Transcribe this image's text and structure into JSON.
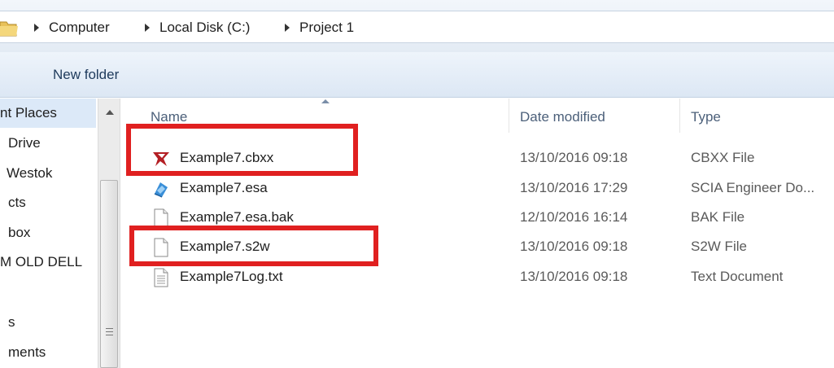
{
  "breadcrumb": [
    "Computer",
    "Local Disk (C:)",
    "Project 1"
  ],
  "toolbar": {
    "new_folder": "New folder"
  },
  "nav": {
    "items": [
      "nt Places",
      "Drive",
      "Westok",
      "cts",
      "box",
      "M OLD DELL",
      "s",
      "ments"
    ]
  },
  "columns": {
    "name": "Name",
    "date": "Date modified",
    "type": "Type"
  },
  "files": [
    {
      "name": "Example7.cbxx",
      "date": "13/10/2016 09:18",
      "type": "CBXX File",
      "icon": "cbxx-file-icon"
    },
    {
      "name": "Example7.esa",
      "date": "13/10/2016 17:29",
      "type": "SCIA Engineer Do...",
      "icon": "scia-file-icon"
    },
    {
      "name": "Example7.esa.bak",
      "date": "12/10/2016 16:14",
      "type": "BAK File",
      "icon": "blank-file-icon"
    },
    {
      "name": "Example7.s2w",
      "date": "13/10/2016 09:18",
      "type": "S2W File",
      "icon": "blank-file-icon"
    },
    {
      "name": "Example7Log.txt",
      "date": "13/10/2016 09:18",
      "type": "Text Document",
      "icon": "text-file-icon"
    }
  ],
  "colors": {
    "highlight": "#e02020",
    "nav_selected": "#dce9f8"
  }
}
